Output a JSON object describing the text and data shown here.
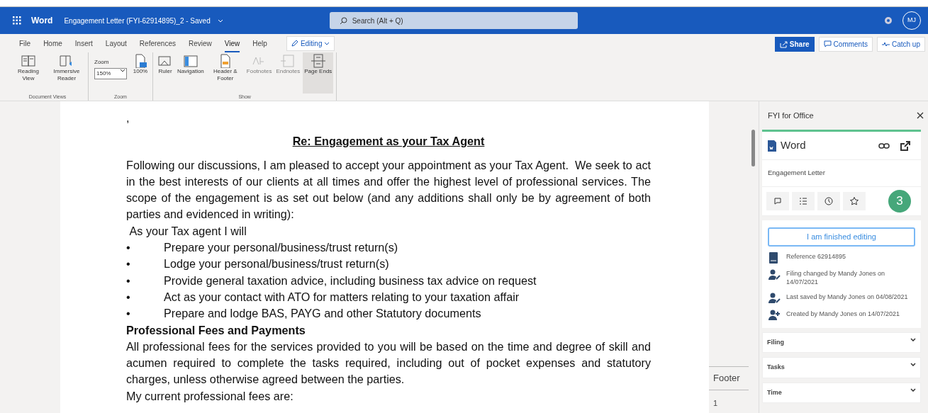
{
  "titlebar": {
    "app": "Word",
    "document_title": "Engagement Letter (FYI-62914895)_2",
    "separator": "-",
    "save_state": "Saved",
    "search": {
      "placeholder": "Search (Alt + Q)"
    },
    "avatar": "MJ"
  },
  "ribbon_tabs": [
    {
      "label": "File",
      "selected": false
    },
    {
      "label": "Home",
      "selected": false
    },
    {
      "label": "Insert",
      "selected": false
    },
    {
      "label": "Layout",
      "selected": false
    },
    {
      "label": "References",
      "selected": false
    },
    {
      "label": "Review",
      "selected": false
    },
    {
      "label": "View",
      "selected": true
    },
    {
      "label": "Help",
      "selected": false
    }
  ],
  "mode_button": "Editing",
  "actions": [
    {
      "label": "Share",
      "kind": "primary"
    },
    {
      "label": "Comments",
      "kind": "comment"
    },
    {
      "label": "Catch up",
      "kind": "catchup"
    }
  ],
  "ribbon_groups": [
    {
      "name": "Document Views",
      "items": [
        {
          "label": "Reading View",
          "kind": "reading",
          "disabled": false,
          "selected": false
        },
        {
          "label": "Immersive Reader",
          "kind": "immersive",
          "disabled": false,
          "selected": false
        }
      ]
    },
    {
      "name": "Zoom",
      "zoom_label": "Zoom",
      "zoom_value": "150%",
      "items": [
        {
          "label": "100%",
          "kind": "page100",
          "disabled": false,
          "selected": false
        }
      ]
    },
    {
      "name": "Show",
      "items": [
        {
          "label": "Ruler",
          "kind": "ruler",
          "disabled": false,
          "selected": false
        },
        {
          "label": "Navigation",
          "kind": "navigation",
          "disabled": false,
          "selected": false
        },
        {
          "label": "Header & Footer",
          "kind": "header",
          "disabled": false,
          "selected": false
        },
        {
          "label": "Footnotes",
          "kind": "footnotes",
          "disabled": true,
          "selected": false
        },
        {
          "label": "Endnotes",
          "kind": "endnotes",
          "disabled": true,
          "selected": false
        },
        {
          "label": "Page Ends",
          "kind": "pageends",
          "disabled": false,
          "selected": true
        }
      ]
    }
  ],
  "document": {
    "blocks": [
      {
        "kind": "text",
        "text": ","
      },
      {
        "kind": "heading",
        "text": "Re: Engagement as your Tax Agent"
      },
      {
        "kind": "paragraph",
        "text": "Following our discussions, I am pleased to accept your appointment as your Tax Agent.  We seek to act in the best interests of our clients at all times and offer the highest level of professional services. The scope of the engagement is as set out below (and any additions shall only be by agreement of both parties and evidenced in writing):"
      },
      {
        "kind": "text",
        "text": " As your Tax agent I will"
      },
      {
        "kind": "bullet",
        "bullet": "•",
        "text": "Prepare your personal/business/trust return(s)"
      },
      {
        "kind": "bullet",
        "bullet": "•",
        "text": "Lodge your personal/business/trust return(s)"
      },
      {
        "kind": "bullet",
        "bullet": "•",
        "text": "Provide general taxation advice, including business tax advice on request"
      },
      {
        "kind": "bullet",
        "bullet": "•",
        "text": "Act as your contact with ATO for matters relating to your taxation affair"
      },
      {
        "kind": "bullet",
        "bullet": "•",
        "text": "Prepare and lodge BAS, PAYG and other Statutory documents"
      },
      {
        "kind": "subheading",
        "text": "Professional Fees and Payments"
      },
      {
        "kind": "paragraph",
        "text": "All professional fees for the services provided to you will be based on the time and degree of skill and acumen required to complete the tasks required, including out of pocket expenses and statutory charges, unless otherwise agreed between the parties."
      },
      {
        "kind": "text",
        "text": "My current professional fees are:"
      }
    ],
    "footer_label": "Footer",
    "page_number": "1"
  },
  "pane": {
    "title": "FYI for Office",
    "app": "Word",
    "document_name": "Engagement Letter",
    "callout": "3",
    "finish_button": "I am finished editing",
    "details": [
      {
        "kind": "reference",
        "text": "Reference 62914895"
      },
      {
        "kind": "edit",
        "text": "Filing changed by Mandy Jones on 14/07/2021"
      },
      {
        "kind": "edit",
        "text": "Last saved by Mandy Jones on 04/08/2021"
      },
      {
        "kind": "add",
        "text": "Created by Mandy Jones on 14/07/2021"
      }
    ],
    "sections": [
      {
        "label": "Filing",
        "expanded": false
      },
      {
        "label": "Tasks",
        "expanded": false
      },
      {
        "label": "Time",
        "expanded": false
      }
    ]
  }
}
